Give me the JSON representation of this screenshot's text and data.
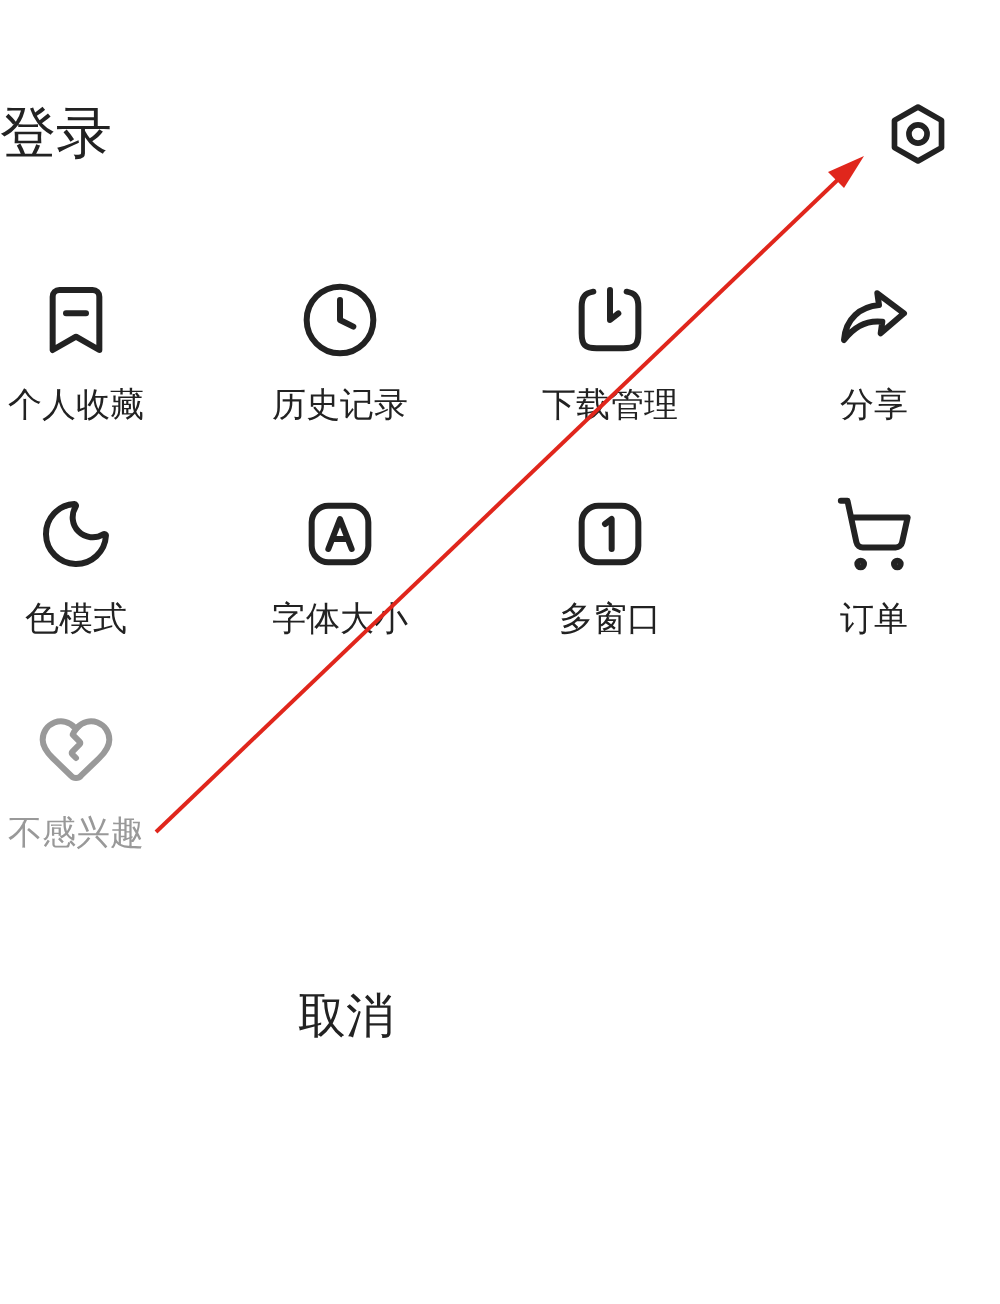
{
  "header": {
    "title": "登录"
  },
  "menu_items": [
    {
      "label": "个人收藏",
      "disabled": false
    },
    {
      "label": "历史记录",
      "disabled": false
    },
    {
      "label": "下载管理",
      "disabled": false
    },
    {
      "label": "分享",
      "disabled": false
    },
    {
      "label": "色模式",
      "disabled": false
    },
    {
      "label": "字体大小",
      "disabled": false
    },
    {
      "label": "多窗口",
      "disabled": false
    },
    {
      "label": "订单",
      "disabled": false
    },
    {
      "label": "不感兴趣",
      "disabled": true
    }
  ],
  "cancel_button": {
    "label": "取消"
  }
}
